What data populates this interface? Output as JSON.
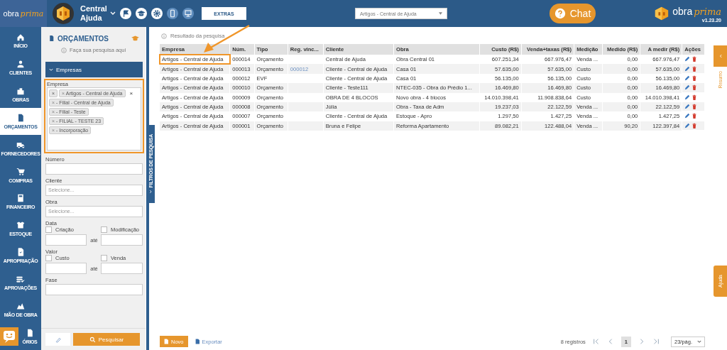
{
  "header": {
    "brand": "obra",
    "brand_script": "prima",
    "workspace": "Central Ajuda",
    "extras_button": "EXTRAS",
    "company_select": "Artigos - Central de Ajuda",
    "chat_button": "Chat",
    "right_brand": "obra",
    "right_brand_script": "prima",
    "version": "v1.23.20"
  },
  "nav": [
    {
      "label": "INÍCIO",
      "selected": false
    },
    {
      "label": "CLIENTES",
      "selected": false
    },
    {
      "label": "OBRAS",
      "selected": false
    },
    {
      "label": "ORÇAMENTOS",
      "selected": true
    },
    {
      "label": "FORNECEDORES",
      "selected": false
    },
    {
      "label": "COMPRAS",
      "selected": false
    },
    {
      "label": "FINANCEIRO",
      "selected": false
    },
    {
      "label": "ESTOQUE",
      "selected": false
    },
    {
      "label": "APROPRIAÇÃO",
      "selected": false
    },
    {
      "label": "APROVAÇÕES",
      "selected": false
    },
    {
      "label": "MÃO DE OBRA",
      "selected": false
    },
    {
      "label": "ÓRIOS",
      "selected": false
    }
  ],
  "filter": {
    "title": "ORÇAMENTOS",
    "hint": "Faça sua pesquisa aqui",
    "section": {
      "label": "Empresas",
      "expanded": true
    },
    "empresa": {
      "label": "Empresa",
      "highlighted": true,
      "blank_chip": "×",
      "clear": "×",
      "tags": [
        {
          "remove": "×",
          "label": "Artigos - Central de Ajuda"
        },
        {
          "remove": "×",
          "label": "- Filial - Central de Ajuda"
        },
        {
          "remove": "×",
          "label": "- Filial - Teste"
        },
        {
          "remove": "×",
          "label": "- FILIAL - TESTE 23"
        },
        {
          "remove": "×",
          "label": "- Incorporação"
        }
      ]
    },
    "fields": [
      {
        "kind": "text",
        "label": "Número"
      },
      {
        "kind": "select",
        "label": "Cliente",
        "placeholder": "Selecione..."
      },
      {
        "kind": "select",
        "label": "Obra",
        "placeholder": "Selecione..."
      },
      {
        "kind": "range",
        "label": "Data",
        "from_label": "Criação",
        "from_checked": false,
        "to_label": "Modificação",
        "to_checked": false,
        "between": "até"
      },
      {
        "kind": "range",
        "label": "Valor",
        "from_label": "Custo",
        "from_checked": false,
        "to_label": "Venda",
        "to_checked": false,
        "between": "até"
      },
      {
        "kind": "text",
        "label": "Fase"
      }
    ],
    "search_button": "Pesquisar",
    "side_tab": "FILTROS DE PESQUISA"
  },
  "results": {
    "hint": "Resultado da pesquisa",
    "columns": [
      {
        "label": "Empresa",
        "numeric": false
      },
      {
        "label": "Núm.",
        "numeric": false
      },
      {
        "label": "Tipo",
        "numeric": false
      },
      {
        "label": "Reg. vinc...",
        "numeric": false
      },
      {
        "label": "Cliente",
        "numeric": false
      },
      {
        "label": "Obra",
        "numeric": false
      },
      {
        "label": "Custo (R$)",
        "numeric": true
      },
      {
        "label": "Venda+taxas (R$)",
        "numeric": true
      },
      {
        "label": "Medição",
        "numeric": false
      },
      {
        "label": "Medido (R$)",
        "numeric": true
      },
      {
        "label": "A medir (R$)",
        "numeric": true
      },
      {
        "label": "Ações",
        "numeric": false
      }
    ],
    "rows": [
      {
        "highlighted": true,
        "empresa": "Artigos - Central de Ajuda",
        "num": "000014",
        "tipo": "Orçamento",
        "cliente": "Central de Ajuda",
        "obra": "Obra Central 01",
        "custo": "607.251,34",
        "venda": "667.976,47",
        "medicao": "Venda ...",
        "medido": "0,00",
        "a_medir": "667.976,47"
      },
      {
        "highlighted": false,
        "empresa": "Artigos - Central de Ajuda",
        "num": "000013",
        "tipo": "Orçamento",
        "reg_vinc": "000012",
        "cliente": "Cliente - Central de Ajuda",
        "obra": "Casa 01",
        "custo": "57.635,00",
        "venda": "57.635,00",
        "medicao": "Custo",
        "medido": "0,00",
        "a_medir": "57.635,00"
      },
      {
        "highlighted": false,
        "empresa": "Artigos - Central de Ajuda",
        "num": "000012",
        "tipo": "EVF",
        "cliente": "Cliente - Central de Ajuda",
        "obra": "Casa 01",
        "custo": "56.135,00",
        "venda": "56.135,00",
        "medicao": "Custo",
        "medido": "0,00",
        "a_medir": "56.135,00"
      },
      {
        "highlighted": false,
        "empresa": "Artigos - Central de Ajuda",
        "num": "000010",
        "tipo": "Orçamento",
        "cliente": "Cliente - Teste111",
        "obra": "NTEC-035 - Obra do Prédio 1...",
        "custo": "16.469,80",
        "venda": "16.469,80",
        "medicao": "Custo",
        "medido": "0,00",
        "a_medir": "16.469,80"
      },
      {
        "highlighted": false,
        "empresa": "Artigos - Central de Ajuda",
        "num": "000009",
        "tipo": "Orçamento",
        "cliente": "OBRA DE 4 BLOCOS",
        "obra": "Novo obra - 4 blocos",
        "custo": "14.010.398,41",
        "venda": "11.908.838,64",
        "medicao": "Custo",
        "medido": "0,00",
        "a_medir": "14.010.398,41"
      },
      {
        "highlighted": false,
        "empresa": "Artigos - Central de Ajuda",
        "num": "000008",
        "tipo": "Orçamento",
        "cliente": "Júlia",
        "obra": "Obra - Taxa de Adm",
        "custo": "19.237,03",
        "venda": "22.122,59",
        "medicao": "Venda ...",
        "medido": "0,00",
        "a_medir": "22.122,59"
      },
      {
        "highlighted": false,
        "empresa": "Artigos - Central de Ajuda",
        "num": "000007",
        "tipo": "Orçamento",
        "cliente": "Cliente - Central de Ajuda",
        "obra": "Estoque - Apro",
        "custo": "1.297,50",
        "venda": "1.427,25",
        "medicao": "Venda ...",
        "medido": "0,00",
        "a_medir": "1.427,25"
      },
      {
        "highlighted": false,
        "empresa": "Artigos - Central de Ajuda",
        "num": "000001",
        "tipo": "Orçamento",
        "cliente": "Bruna e Felipe",
        "obra": "Reforma Apartamento",
        "custo": "89.082,21",
        "venda": "122.488,04",
        "medicao": "Venda ...",
        "medido": "90,20",
        "a_medir": "122.397,84"
      }
    ],
    "new_button": "Novo",
    "export_link": "Exportar",
    "count": "8 registros",
    "pages": [
      {
        "label": "1",
        "selected": true
      }
    ],
    "per_page": "23/pág."
  },
  "right_tabs": {
    "summary": "Resumo",
    "help": "Ajuda"
  }
}
